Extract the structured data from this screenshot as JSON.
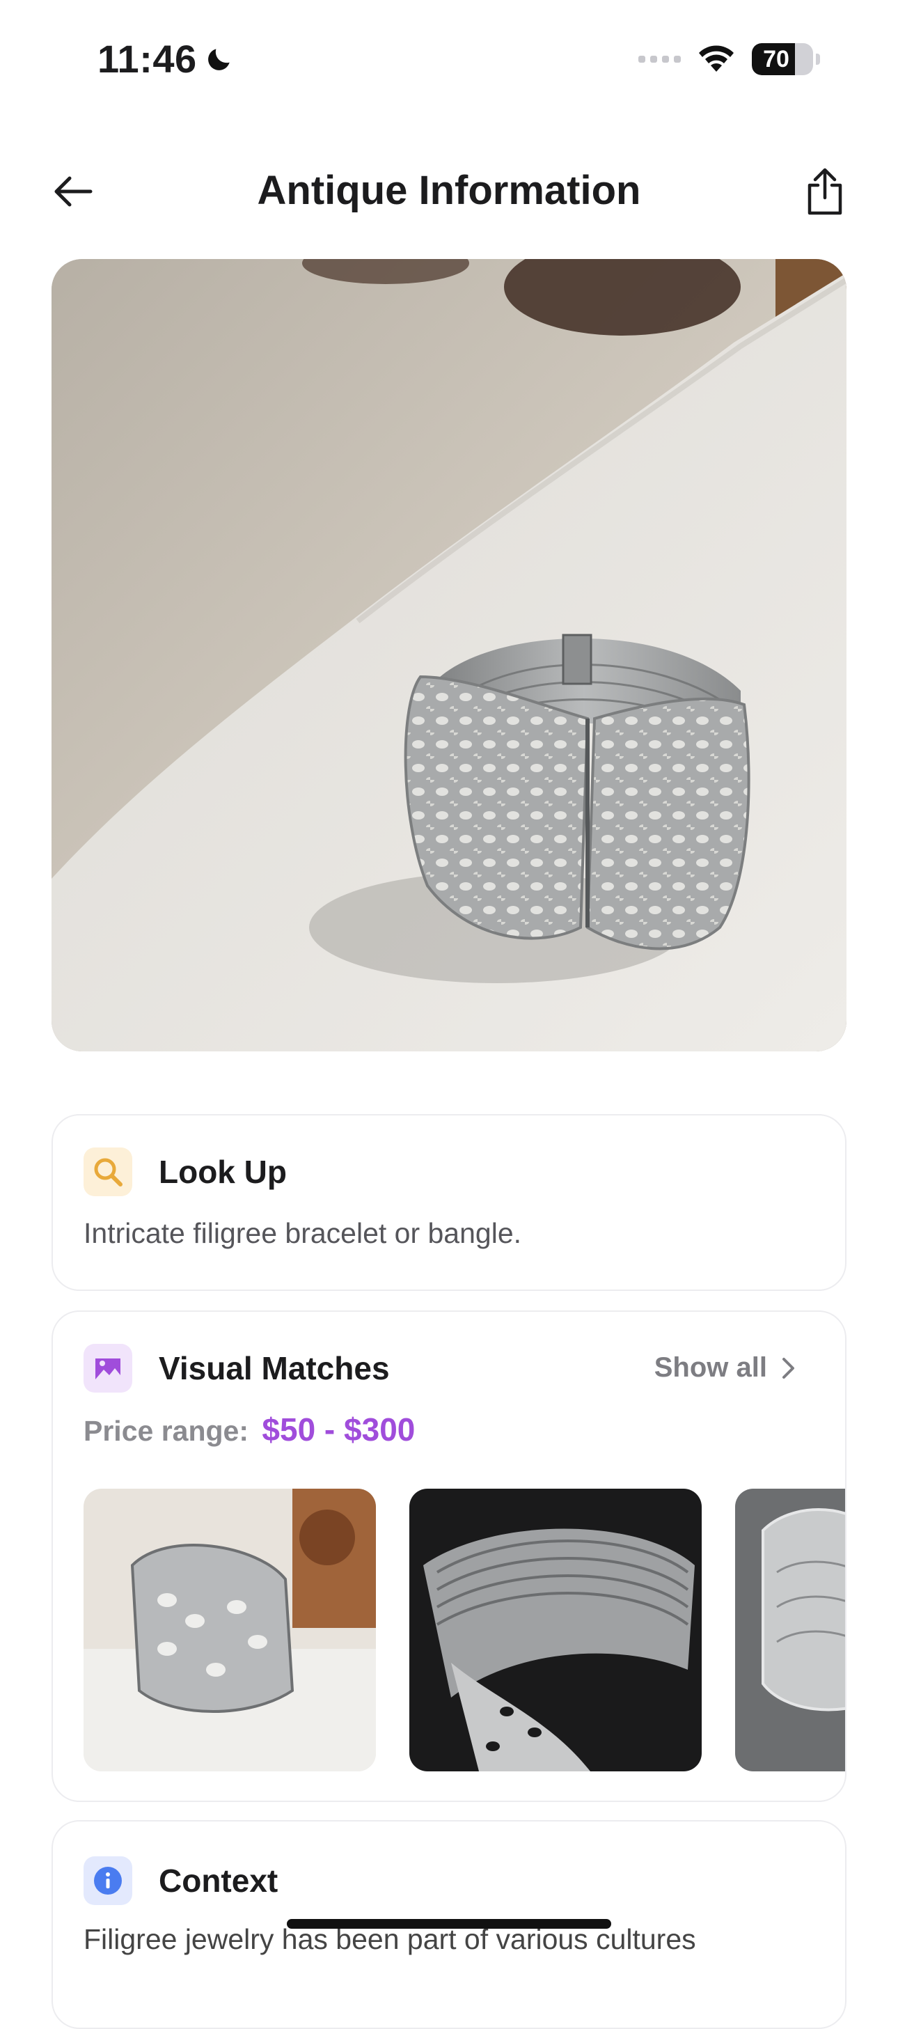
{
  "status_bar": {
    "time": "11:46",
    "battery": "70",
    "battery_level": 0.7
  },
  "nav": {
    "title": "Antique Information"
  },
  "hero": {
    "subject": "filigree-bracelet-photo"
  },
  "lookup": {
    "title": "Look Up",
    "description": "Intricate filigree bracelet or bangle.",
    "icon": "search-icon",
    "icon_color": "#e8a93a",
    "badge_color": "#fdf0d8"
  },
  "visual_matches": {
    "title": "Visual Matches",
    "show_all": "Show all",
    "price_label": "Price range:",
    "price_value": "$50 - $300",
    "price_color": "#a04ddb",
    "icon": "gallery-icon",
    "badge_color": "#f1e4fb",
    "thumbnails": [
      "bracelet-match-1",
      "bracelet-match-2",
      "bracelet-match-3"
    ]
  },
  "context": {
    "title": "Context",
    "text": "Filigree jewelry has been part of various cultures",
    "icon": "info-icon",
    "badge_color": "#e3e9fd",
    "icon_color": "#4a7cf0"
  }
}
